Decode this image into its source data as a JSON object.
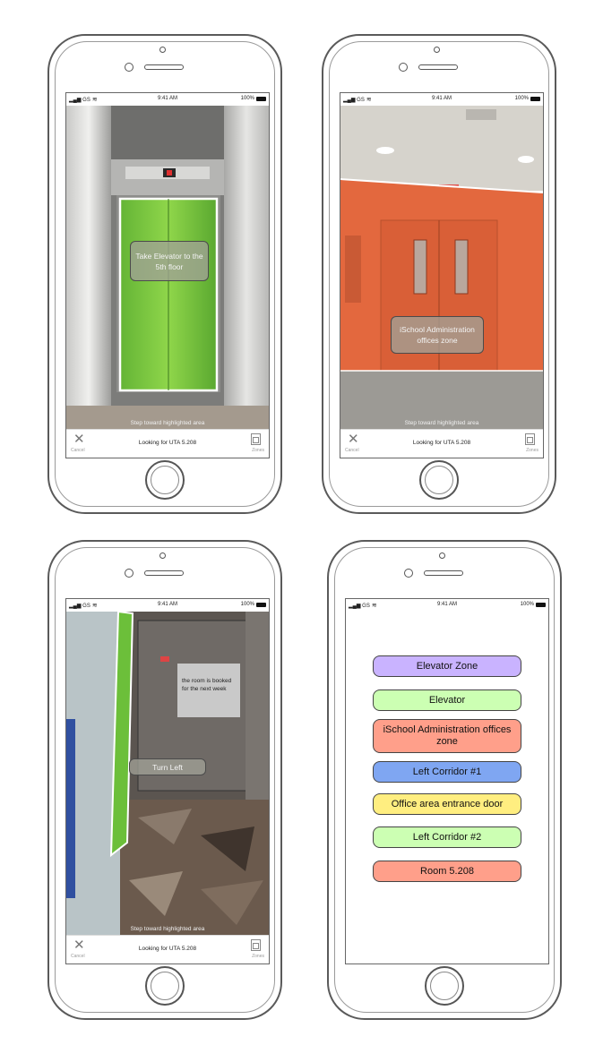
{
  "status": {
    "carrier": "GS",
    "time": "9:41 AM",
    "battery": "100%"
  },
  "screens": [
    {
      "bubble": "Take Elevator to the 5th floor",
      "hint": "Step toward highlighted area",
      "bottom": {
        "cancel": "Cancel",
        "title": "Looking for UTA 5.208",
        "zones": "Zones"
      }
    },
    {
      "bubble": "iSchool Administration offices zone",
      "hint": "Step toward highlighted area",
      "bottom": {
        "cancel": "Cancel",
        "title": "Looking for UTA 5.208",
        "zones": "Zones"
      }
    },
    {
      "bubble": "Turn Left",
      "note": "the room is booked for the next week",
      "hint": "Step toward highlighted area",
      "bottom": {
        "cancel": "Cancel",
        "title": "Looking for UTA 5.208",
        "zones": "Zones"
      }
    }
  ],
  "zones": [
    {
      "label": "Elevator Zone",
      "color": "#c9b3ff"
    },
    {
      "label": "Elevator",
      "color": "#ccffb3"
    },
    {
      "label": "iSchool Administration offices zone",
      "color": "#ff9f8a"
    },
    {
      "label": "Left Corridor #1",
      "color": "#7fa6f2"
    },
    {
      "label": "Office area entrance door",
      "color": "#ffee80"
    },
    {
      "label": "Left Corridor #2",
      "color": "#ccffb3"
    },
    {
      "label": "Room 5.208",
      "color": "#ff9f8a"
    }
  ],
  "icons": {
    "cancel": "close-icon",
    "zones": "zones-icon",
    "signal": "signal-icon",
    "wifi": "wifi-icon",
    "battery": "battery-icon"
  }
}
